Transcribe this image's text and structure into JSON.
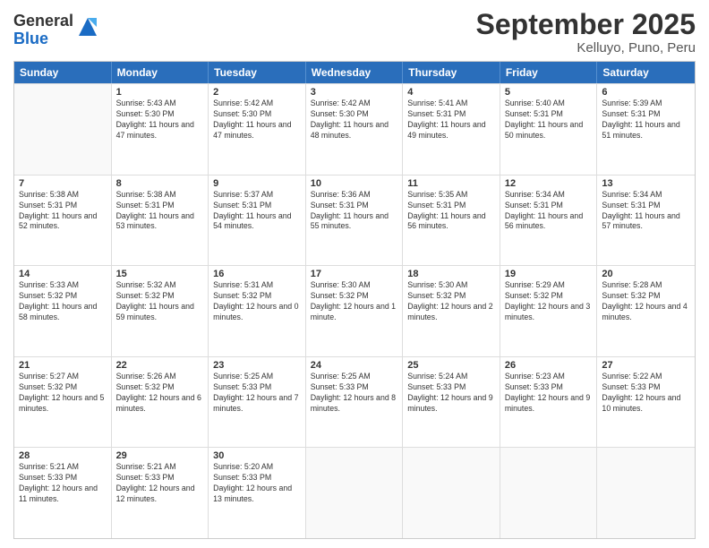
{
  "logo": {
    "general": "General",
    "blue": "Blue"
  },
  "title": "September 2025",
  "location": "Kelluyo, Puno, Peru",
  "days": [
    "Sunday",
    "Monday",
    "Tuesday",
    "Wednesday",
    "Thursday",
    "Friday",
    "Saturday"
  ],
  "weeks": [
    [
      {
        "day": "",
        "empty": true
      },
      {
        "day": "1",
        "sunrise": "5:43 AM",
        "sunset": "5:30 PM",
        "daylight": "11 hours and 47 minutes."
      },
      {
        "day": "2",
        "sunrise": "5:42 AM",
        "sunset": "5:30 PM",
        "daylight": "11 hours and 47 minutes."
      },
      {
        "day": "3",
        "sunrise": "5:42 AM",
        "sunset": "5:30 PM",
        "daylight": "11 hours and 48 minutes."
      },
      {
        "day": "4",
        "sunrise": "5:41 AM",
        "sunset": "5:31 PM",
        "daylight": "11 hours and 49 minutes."
      },
      {
        "day": "5",
        "sunrise": "5:40 AM",
        "sunset": "5:31 PM",
        "daylight": "11 hours and 50 minutes."
      },
      {
        "day": "6",
        "sunrise": "5:39 AM",
        "sunset": "5:31 PM",
        "daylight": "11 hours and 51 minutes."
      }
    ],
    [
      {
        "day": "7",
        "sunrise": "5:38 AM",
        "sunset": "5:31 PM",
        "daylight": "11 hours and 52 minutes."
      },
      {
        "day": "8",
        "sunrise": "5:38 AM",
        "sunset": "5:31 PM",
        "daylight": "11 hours and 53 minutes."
      },
      {
        "day": "9",
        "sunrise": "5:37 AM",
        "sunset": "5:31 PM",
        "daylight": "11 hours and 54 minutes."
      },
      {
        "day": "10",
        "sunrise": "5:36 AM",
        "sunset": "5:31 PM",
        "daylight": "11 hours and 55 minutes."
      },
      {
        "day": "11",
        "sunrise": "5:35 AM",
        "sunset": "5:31 PM",
        "daylight": "11 hours and 56 minutes."
      },
      {
        "day": "12",
        "sunrise": "5:34 AM",
        "sunset": "5:31 PM",
        "daylight": "11 hours and 56 minutes."
      },
      {
        "day": "13",
        "sunrise": "5:34 AM",
        "sunset": "5:31 PM",
        "daylight": "11 hours and 57 minutes."
      }
    ],
    [
      {
        "day": "14",
        "sunrise": "5:33 AM",
        "sunset": "5:32 PM",
        "daylight": "11 hours and 58 minutes."
      },
      {
        "day": "15",
        "sunrise": "5:32 AM",
        "sunset": "5:32 PM",
        "daylight": "11 hours and 59 minutes."
      },
      {
        "day": "16",
        "sunrise": "5:31 AM",
        "sunset": "5:32 PM",
        "daylight": "12 hours and 0 minutes."
      },
      {
        "day": "17",
        "sunrise": "5:30 AM",
        "sunset": "5:32 PM",
        "daylight": "12 hours and 1 minute."
      },
      {
        "day": "18",
        "sunrise": "5:30 AM",
        "sunset": "5:32 PM",
        "daylight": "12 hours and 2 minutes."
      },
      {
        "day": "19",
        "sunrise": "5:29 AM",
        "sunset": "5:32 PM",
        "daylight": "12 hours and 3 minutes."
      },
      {
        "day": "20",
        "sunrise": "5:28 AM",
        "sunset": "5:32 PM",
        "daylight": "12 hours and 4 minutes."
      }
    ],
    [
      {
        "day": "21",
        "sunrise": "5:27 AM",
        "sunset": "5:32 PM",
        "daylight": "12 hours and 5 minutes."
      },
      {
        "day": "22",
        "sunrise": "5:26 AM",
        "sunset": "5:32 PM",
        "daylight": "12 hours and 6 minutes."
      },
      {
        "day": "23",
        "sunrise": "5:25 AM",
        "sunset": "5:33 PM",
        "daylight": "12 hours and 7 minutes."
      },
      {
        "day": "24",
        "sunrise": "5:25 AM",
        "sunset": "5:33 PM",
        "daylight": "12 hours and 8 minutes."
      },
      {
        "day": "25",
        "sunrise": "5:24 AM",
        "sunset": "5:33 PM",
        "daylight": "12 hours and 9 minutes."
      },
      {
        "day": "26",
        "sunrise": "5:23 AM",
        "sunset": "5:33 PM",
        "daylight": "12 hours and 9 minutes."
      },
      {
        "day": "27",
        "sunrise": "5:22 AM",
        "sunset": "5:33 PM",
        "daylight": "12 hours and 10 minutes."
      }
    ],
    [
      {
        "day": "28",
        "sunrise": "5:21 AM",
        "sunset": "5:33 PM",
        "daylight": "12 hours and 11 minutes."
      },
      {
        "day": "29",
        "sunrise": "5:21 AM",
        "sunset": "5:33 PM",
        "daylight": "12 hours and 12 minutes."
      },
      {
        "day": "30",
        "sunrise": "5:20 AM",
        "sunset": "5:33 PM",
        "daylight": "12 hours and 13 minutes."
      },
      {
        "day": "",
        "empty": true
      },
      {
        "day": "",
        "empty": true
      },
      {
        "day": "",
        "empty": true
      },
      {
        "day": "",
        "empty": true
      }
    ]
  ]
}
